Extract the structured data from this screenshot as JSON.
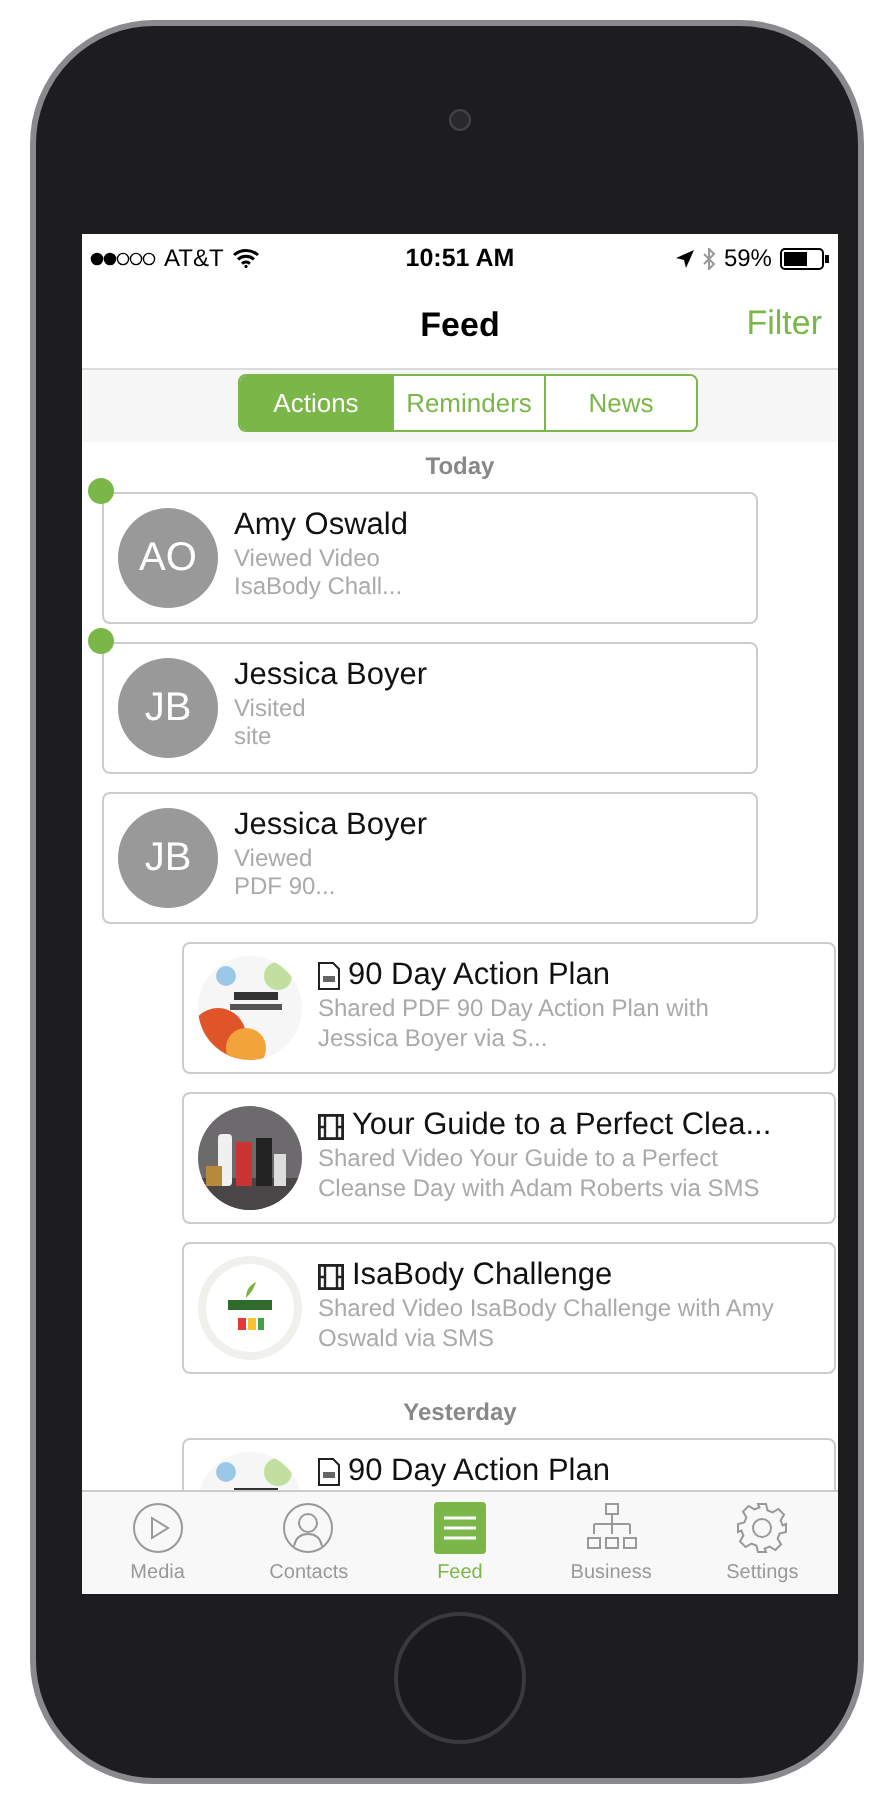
{
  "status_bar": {
    "carrier": "AT&T",
    "time": "10:51 AM",
    "battery": "59%"
  },
  "nav": {
    "title": "Feed",
    "action": "Filter"
  },
  "segments": [
    {
      "label": "Actions",
      "selected": true
    },
    {
      "label": "Reminders",
      "selected": false
    },
    {
      "label": "News",
      "selected": false
    }
  ],
  "feed": [
    {
      "kind": "header",
      "label": "Today"
    },
    {
      "kind": "contact",
      "initials": "AO",
      "name": "Amy Oswald",
      "line_1": "Viewed Video",
      "line_2": "IsaBody Chall...",
      "unread": true
    },
    {
      "kind": "contact",
      "initials": "JB",
      "name": "Jessica Boyer",
      "line_1": "Visited",
      "line_2": "site",
      "unread": true
    },
    {
      "kind": "contact",
      "initials": "JB",
      "name": "Jessica Boyer",
      "line_1": "Viewed",
      "line_2": "PDF 90...",
      "unread": false
    },
    {
      "kind": "pdf_share",
      "title": "90 Day Action Plan",
      "detail": "Shared PDF 90 Day Action Plan with Jessica Boyer via S..."
    },
    {
      "kind": "video_share",
      "title": "Your Guide to a Perfect Clea...",
      "detail": "Shared Video Your Guide to a Perfect Cleanse Day with Adam Roberts via SMS"
    },
    {
      "kind": "video_share",
      "title": "IsaBody Challenge",
      "detail": "Shared Video IsaBody Challenge with Amy Oswald via SMS"
    },
    {
      "kind": "header",
      "label": "Yesterday"
    },
    {
      "kind": "pdf_share",
      "title": "90 Day Action Plan"
    }
  ],
  "tab_bar": [
    {
      "label": "Media",
      "selected": false
    },
    {
      "label": "Contacts",
      "selected": false
    },
    {
      "label": "Feed",
      "selected": true
    },
    {
      "label": "Business",
      "selected": false
    },
    {
      "label": "Settings",
      "selected": false
    }
  ]
}
